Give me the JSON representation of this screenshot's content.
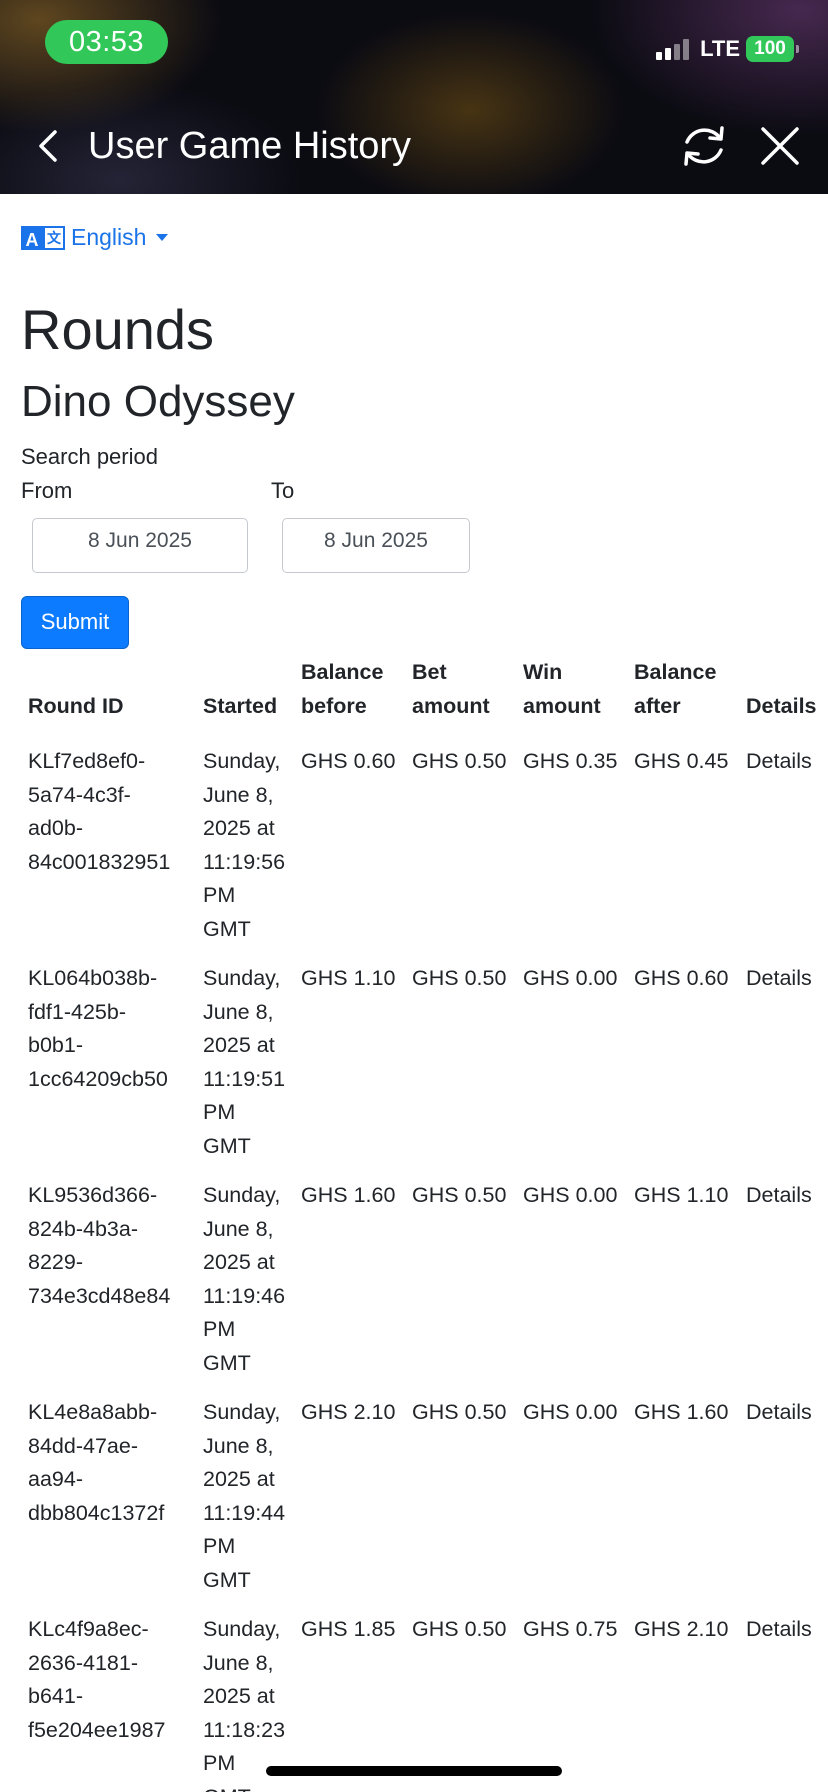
{
  "status_bar": {
    "time": "03:53",
    "network": "LTE",
    "battery": "100"
  },
  "header": {
    "title": "User Game History",
    "back_icon": "chevron-left-icon",
    "refresh_icon": "refresh-icon",
    "close_icon": "close-icon"
  },
  "language": {
    "selected": "English",
    "icon": "translate-icon"
  },
  "page": {
    "heading": "Rounds",
    "game_name": "Dino Odyssey"
  },
  "search": {
    "period_label": "Search period",
    "from_label": "From",
    "to_label": "To",
    "from_value": "8 Jun 2025",
    "to_value": "8 Jun 2025",
    "submit_label": "Submit"
  },
  "table": {
    "headers": {
      "round_id": "Round ID",
      "started": "Started",
      "balance_before": "Balance before",
      "bet_amount": "Bet amount",
      "win_amount": "Win amount",
      "balance_after": "Balance after",
      "details": "Details"
    },
    "rows": [
      {
        "round_id": [
          "KLf7ed8ef0-",
          "5a74-4c3f-",
          "ad0b-",
          "84c001832951"
        ],
        "started": [
          "Sunday,",
          "June 8,",
          "2025 at",
          "11:19:56",
          "PM",
          "GMT"
        ],
        "balance_before": "GHS 0.60",
        "bet_amount": "GHS 0.50",
        "win_amount": "GHS 0.35",
        "balance_after": "GHS 0.45",
        "details": "Details"
      },
      {
        "round_id": [
          "KL064b038b-",
          "fdf1-425b-",
          "b0b1-",
          "1cc64209cb50"
        ],
        "started": [
          "Sunday,",
          "June 8,",
          "2025 at",
          "11:19:51",
          "PM",
          "GMT"
        ],
        "balance_before": "GHS 1.10",
        "bet_amount": "GHS 0.50",
        "win_amount": "GHS 0.00",
        "balance_after": "GHS 0.60",
        "details": "Details"
      },
      {
        "round_id": [
          "KL9536d366-",
          "824b-4b3a-",
          "8229-",
          "734e3cd48e84"
        ],
        "started": [
          "Sunday,",
          "June 8,",
          "2025 at",
          "11:19:46",
          "PM",
          "GMT"
        ],
        "balance_before": "GHS 1.60",
        "bet_amount": "GHS 0.50",
        "win_amount": "GHS 0.00",
        "balance_after": "GHS 1.10",
        "details": "Details"
      },
      {
        "round_id": [
          "KL4e8a8abb-",
          "84dd-47ae-",
          "aa94-",
          "dbb804c1372f"
        ],
        "started": [
          "Sunday,",
          "June 8,",
          "2025 at",
          "11:19:44",
          "PM",
          "GMT"
        ],
        "balance_before": "GHS 2.10",
        "bet_amount": "GHS 0.50",
        "win_amount": "GHS 0.00",
        "balance_after": "GHS 1.60",
        "details": "Details"
      },
      {
        "round_id": [
          "KLc4f9a8ec-",
          "2636-4181-",
          "b641-",
          "f5e204ee1987"
        ],
        "started": [
          "Sunday,",
          "June 8,",
          "2025 at",
          "11:18:23",
          "PM",
          "GMT"
        ],
        "balance_before": "GHS 1.85",
        "bet_amount": "GHS 0.50",
        "win_amount": "GHS 0.75",
        "balance_after": "GHS 2.10",
        "details": "Details"
      }
    ]
  },
  "colors": {
    "link": "#1a73e8",
    "submit_bg": "#0d7bff",
    "time_pill": "#32c759",
    "battery": "#32c759"
  }
}
